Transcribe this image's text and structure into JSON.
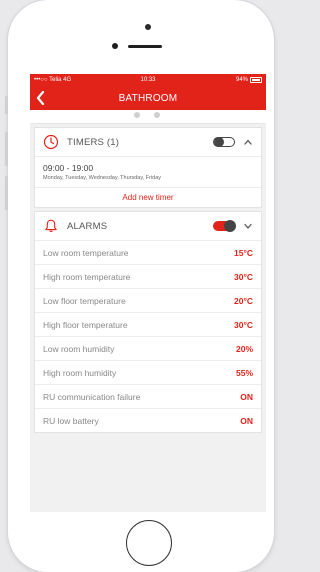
{
  "statusbar": {
    "carrier": "•••○○ Telia 4G",
    "time": "10:33",
    "battery_text": "94%"
  },
  "navbar": {
    "title": "BATHROOM"
  },
  "timers": {
    "title": "TIMERS (1)",
    "enabled": false,
    "entries": [
      {
        "time": "09:00 - 19:00",
        "days": "Monday, Tuesday, Wednesday, Thursday, Friday"
      }
    ],
    "add_label": "Add new timer"
  },
  "alarms": {
    "title": "ALARMS",
    "enabled": true,
    "rows": [
      {
        "label": "Low room temperature",
        "value": "15°C"
      },
      {
        "label": "High room temperature",
        "value": "30°C"
      },
      {
        "label": "Low floor temperature",
        "value": "20°C"
      },
      {
        "label": "High floor temperature",
        "value": "30°C"
      },
      {
        "label": "Low room humidity",
        "value": "20%"
      },
      {
        "label": "High room humidity",
        "value": "55%"
      },
      {
        "label": "RU communication failure",
        "value": "ON"
      },
      {
        "label": "RU low battery",
        "value": "ON"
      }
    ]
  },
  "colors": {
    "accent": "#e2231a",
    "toggle_knob": "#444444"
  },
  "icons": {
    "back": "chevron-left-icon",
    "timer": "clock-icon",
    "alarm": "bell-icon",
    "timers_collapse": "chevron-up-icon",
    "alarms_expand": "chevron-down-icon"
  }
}
